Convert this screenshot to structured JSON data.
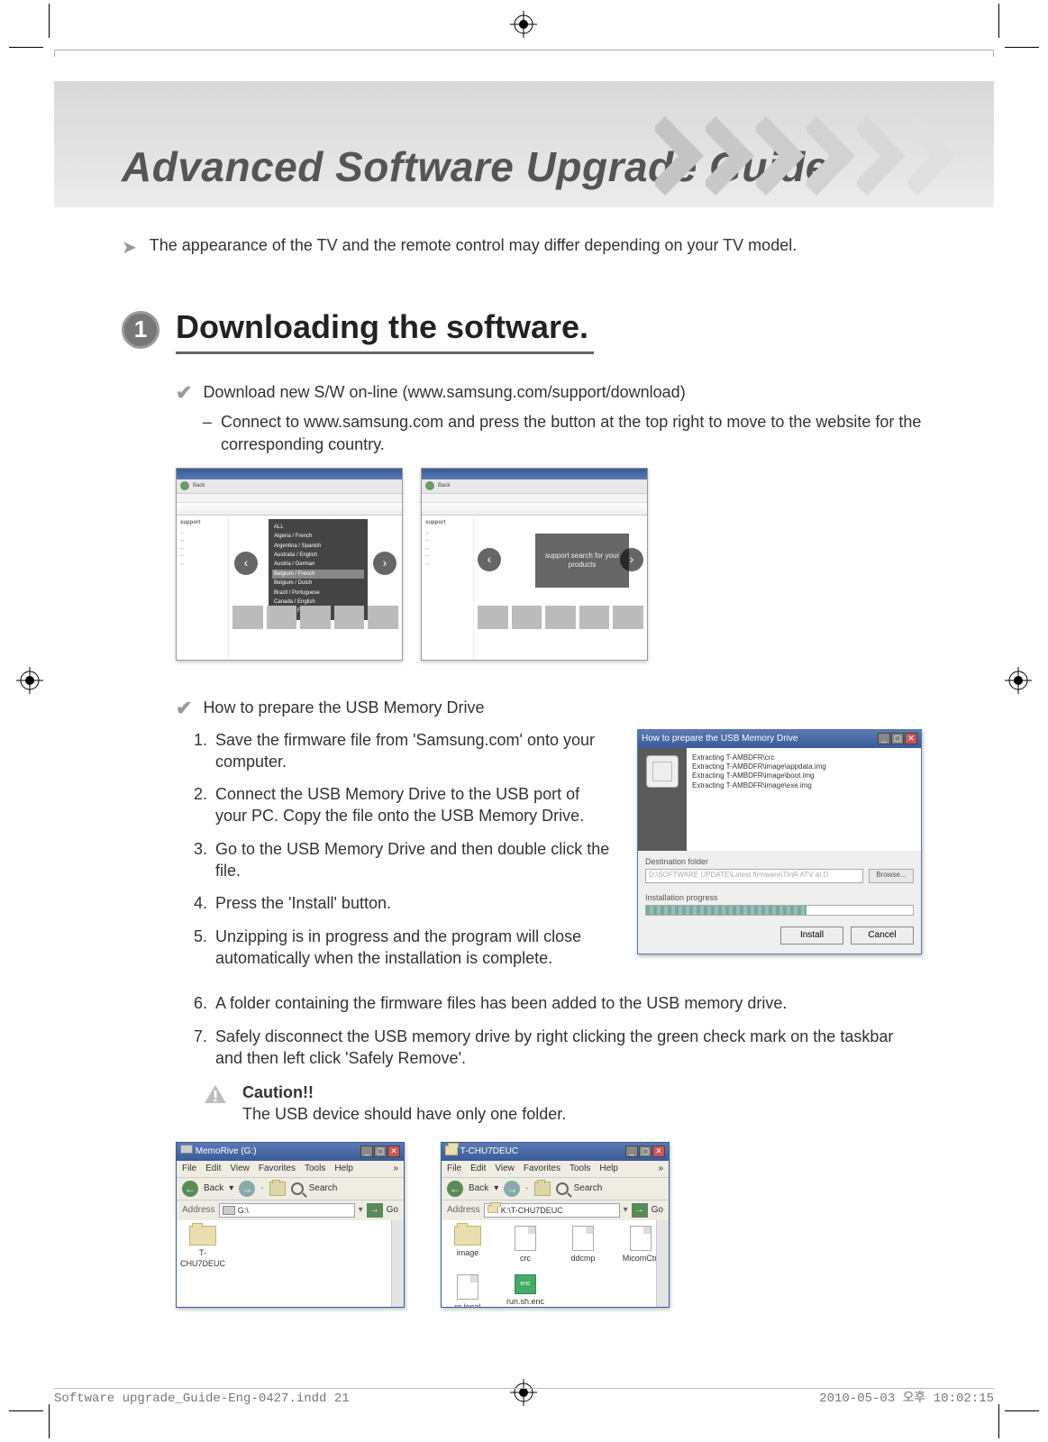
{
  "title": "Advanced Software Upgrade Guide",
  "intro_note": "The appearance of the TV and the remote control may differ depending on your TV model.",
  "step": {
    "number": "1",
    "heading": "Downloading the software.",
    "bullet1": "Download new S/W on-line (www.samsung.com/support/download)",
    "bullet1_sub": "Connect to www.samsung.com and press the button at the top right to move to the website for the corresponding country.",
    "bullet2": "How to prepare the USB Memory Drive",
    "steps": [
      "Save the firmware file from 'Samsung.com' onto your computer.",
      "Connect the USB Memory Drive to the USB port of your PC. Copy the file onto the USB Memory Drive.",
      "Go to the USB Memory Drive and then double click the file.",
      "Press the 'Install' button.",
      "Unzipping is in progress and the program will close automatically when the installation is complete."
    ],
    "steps_tail": [
      "A folder containing the firmware files has been added to the USB memory drive.",
      "Safely disconnect the USB memory drive by right clicking the green check mark on the taskbar and then left click 'Safely Remove'."
    ],
    "caution_title": "Caution!!",
    "caution_text": "The USB device should have only one folder."
  },
  "browser_shots": {
    "toolbar": {
      "back": "Back"
    },
    "sidebar": {
      "head": "support"
    },
    "dropdown": [
      "ALL",
      "Algeria / French",
      "Argentina / Spanish",
      "Australia / English",
      "Austria / German",
      "Belgium / French",
      "Belgium / Dutch",
      "Brazil / Portuguese",
      "Canada / English",
      "Canada / French"
    ],
    "support_banner": "support search for your products"
  },
  "installer": {
    "title": "How to prepare the USB Memory Drive",
    "lines": [
      "Extracting T-AMBDFR\\crc",
      "Extracting T-AMBDFR\\image\\appdata.img",
      "Extracting T-AMBDFR\\image\\boot.img",
      "Extracting T-AMBDFR\\image\\exe.img"
    ],
    "dest_label": "Destination folder",
    "dest_path": "D:\\SOFTWARE UPDATE\\Latest firmware\\TInR ATV at D",
    "browse": "Browse...",
    "prog_label": "Installation progress",
    "btn_install": "Install",
    "btn_cancel": "Cancel"
  },
  "explorer1": {
    "title": "MemoRive (G:)",
    "menu": [
      "File",
      "Edit",
      "View",
      "Favorites",
      "Tools",
      "Help"
    ],
    "back": "Back",
    "search": "Search",
    "addr_label": "Address",
    "addr_value": "G:\\",
    "go": "Go",
    "items": [
      "T-CHU7DEUC"
    ]
  },
  "explorer2": {
    "title": "T-CHU7DEUC",
    "menu": [
      "File",
      "Edit",
      "View",
      "Favorites",
      "Tools",
      "Help"
    ],
    "back": "Back",
    "search": "Search",
    "addr_label": "Address",
    "addr_value": "K:\\T-CHU7DEUC",
    "go": "Go",
    "items": [
      "image",
      "crc",
      "ddcmp",
      "MicomCtrl",
      "rc.local",
      "run.sh.enc"
    ]
  },
  "footer": {
    "filename": "Software upgrade_Guide-Eng-0427.indd   21",
    "timestamp": "2010-05-03   오후 10:02:15"
  }
}
